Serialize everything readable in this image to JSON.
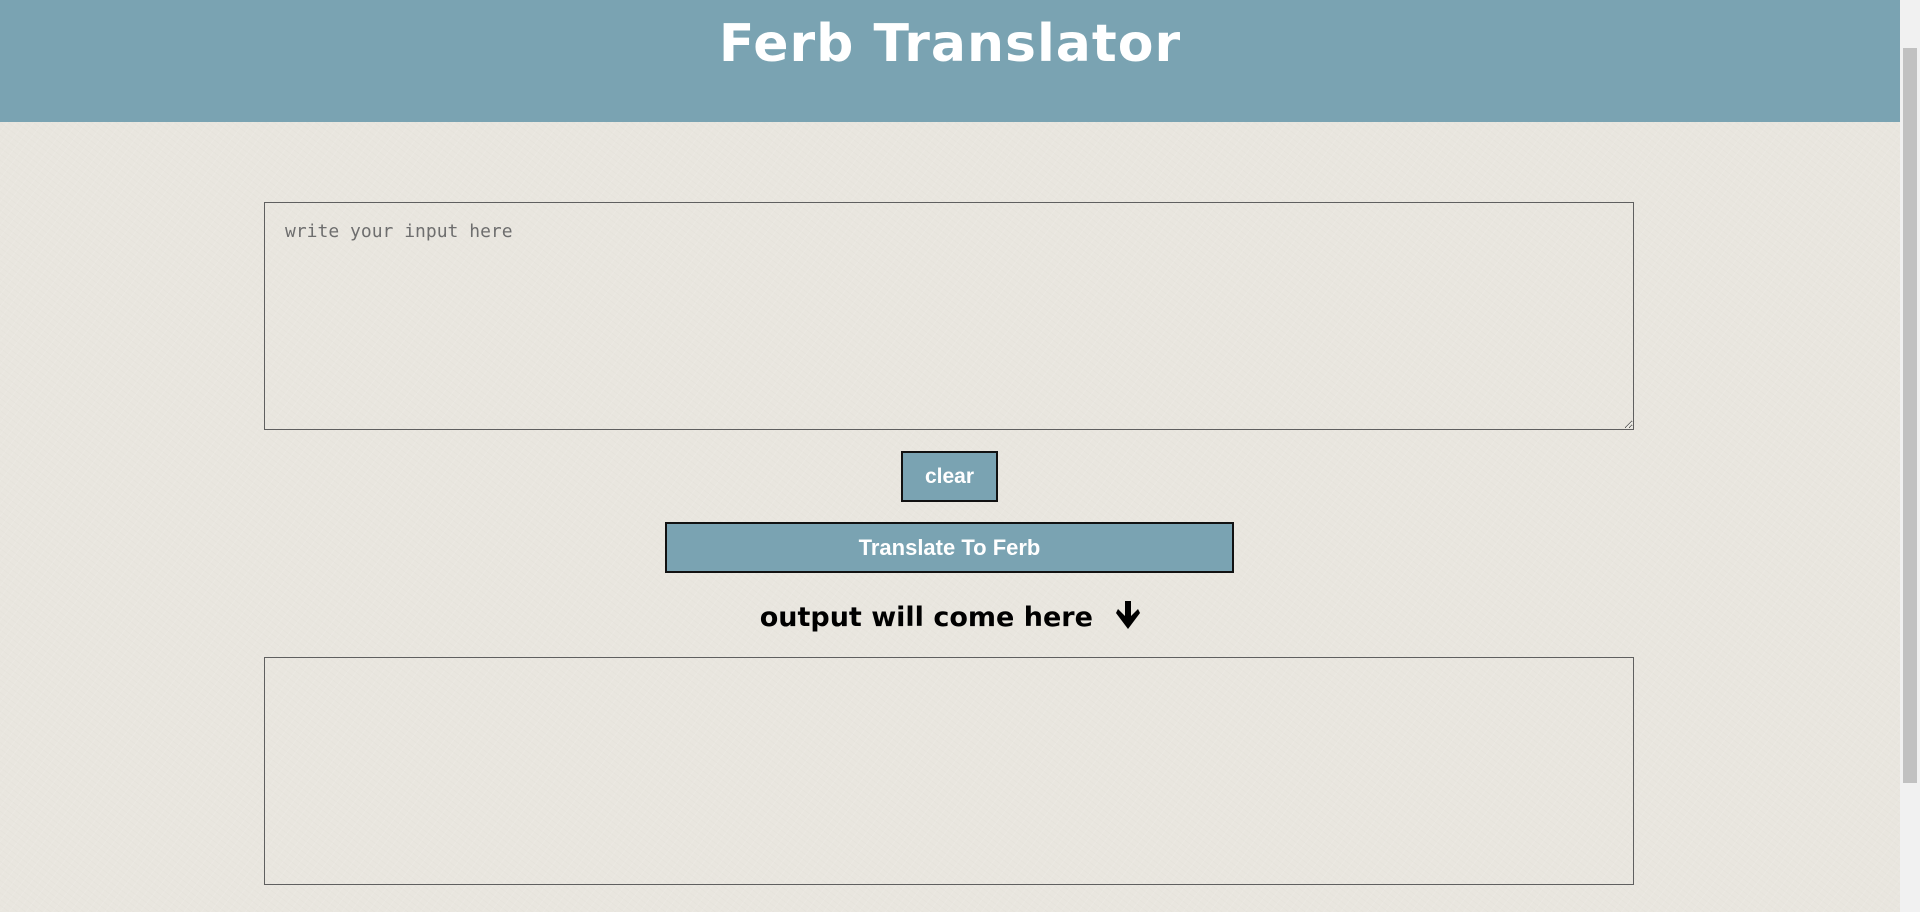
{
  "header": {
    "title": "Ferb Translator",
    "background_color": "#7aa3b2"
  },
  "input": {
    "placeholder": "write your input here",
    "value": ""
  },
  "buttons": {
    "clear_label": "clear",
    "translate_label": "Translate To Ferb"
  },
  "output": {
    "caption": "output will come here",
    "caption_icon": "arrow-down-icon",
    "value": ""
  },
  "colors": {
    "page_background": "#e9e6df",
    "accent": "#7aa3b2",
    "text": "#000000",
    "button_text": "#ffffff"
  }
}
